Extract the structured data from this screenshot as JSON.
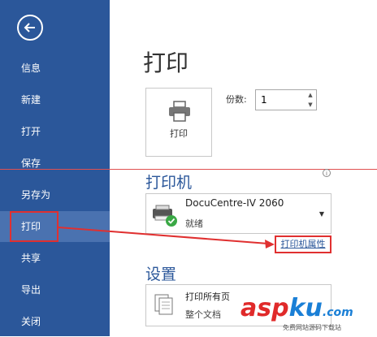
{
  "sidebar": {
    "items": [
      {
        "label": "信息"
      },
      {
        "label": "新建"
      },
      {
        "label": "打开"
      },
      {
        "label": "保存"
      },
      {
        "label": "另存为"
      },
      {
        "label": "打印"
      },
      {
        "label": "共享"
      },
      {
        "label": "导出"
      },
      {
        "label": "关闭"
      }
    ]
  },
  "main": {
    "title": "打印",
    "print_button_label": "打印",
    "copies_label": "份数:",
    "copies_value": "1",
    "printer_section": "打印机",
    "printer_name": "DocuCentre-IV 2060",
    "printer_status": "就绪",
    "printer_properties_link": "打印机属性",
    "settings_section": "设置",
    "setting_title": "打印所有页",
    "setting_sub": "整个文档"
  },
  "watermark": {
    "brand_a": "asp",
    "brand_b": "ku",
    "brand_c": ".com",
    "sub": "免费网站源码下载站"
  },
  "colors": {
    "sidebar": "#2b579a",
    "active": "#4a72b0",
    "highlight": "#e03030"
  }
}
